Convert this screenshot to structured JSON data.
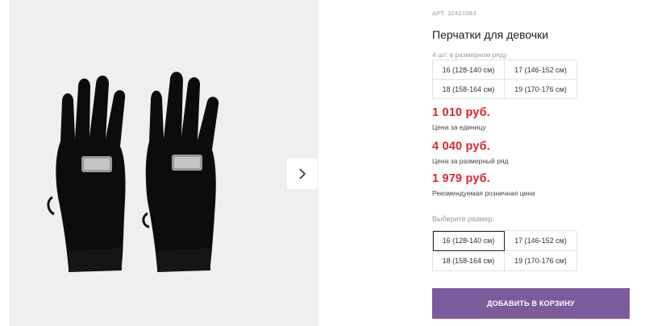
{
  "product": {
    "sku_label": "АРТ. 32421083",
    "title": "Перчатки для девочки",
    "pack_count": "4 шт. в размерном ряду",
    "pack_sizes": [
      "16 (128-140 см)",
      "17 (146-152 см)",
      "18 (158-164 см)",
      "19 (170-176 см)"
    ]
  },
  "prices": [
    {
      "value": "1 010 руб.",
      "note": "Цена за единицу"
    },
    {
      "value": "4 040 руб.",
      "note": "Цена за размерный ряд"
    },
    {
      "value": "1 979 руб.",
      "note": "Рекомендуемая розничная цена"
    }
  ],
  "size_select": {
    "label": "Выберите размер:",
    "options": [
      "16 (128-140 см)",
      "17 (146-152 см)",
      "18 (158-164 см)",
      "19 (170-176 см)"
    ],
    "selected": "16 (128-140 см)"
  },
  "cart": {
    "add_label": "ДОБАВИТЬ В КОРЗИНУ"
  },
  "gallery": {
    "next_icon": "chevron-right-icon",
    "image": "black-gloves-photo"
  },
  "colors": {
    "price": "#e2222e",
    "button": "#7b5b9b",
    "gallery_bg": "#efefef"
  }
}
